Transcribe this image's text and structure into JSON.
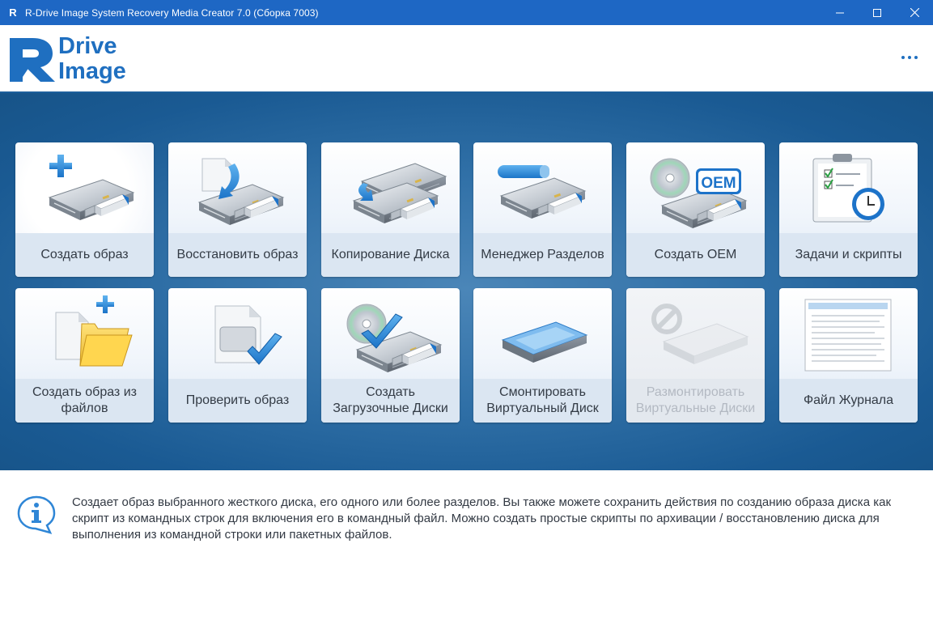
{
  "window": {
    "title": "R-Drive Image System Recovery Media Creator 7.0 (Сборка 7003)",
    "app_icon_letter": "R"
  },
  "header": {
    "logo_line1": "Drive",
    "logo_line2": "Image",
    "brand_color": "#1f6fc0"
  },
  "tiles": [
    {
      "label": "Создать образ",
      "icon": "create-image-icon",
      "state": "selected"
    },
    {
      "label": "Восстановить образ",
      "icon": "restore-image-icon",
      "state": "normal"
    },
    {
      "label": "Копирование Диска",
      "icon": "copy-disk-icon",
      "state": "normal"
    },
    {
      "label": "Менеджер Разделов",
      "icon": "partition-manager-icon",
      "state": "normal"
    },
    {
      "label": "Создать OEM",
      "icon": "create-oem-icon",
      "state": "normal"
    },
    {
      "label": "Задачи и скрипты",
      "icon": "tasks-scripts-icon",
      "state": "normal"
    },
    {
      "label": "Создать образ из файлов",
      "icon": "image-from-files-icon",
      "state": "normal"
    },
    {
      "label": "Проверить образ",
      "icon": "check-image-icon",
      "state": "normal"
    },
    {
      "label": "Создать Загрузочные Диски",
      "icon": "create-boot-disks-icon",
      "state": "normal"
    },
    {
      "label": "Смонтировать Виртуальный Диск",
      "icon": "mount-virtual-disk-icon",
      "state": "normal"
    },
    {
      "label": "Размонтировать Виртуальные Диски",
      "icon": "unmount-virtual-disks-icon",
      "state": "disabled"
    },
    {
      "label": "Файл Журнала",
      "icon": "log-file-icon",
      "state": "normal"
    }
  ],
  "icons_text": {
    "oem_badge": "OEM"
  },
  "info": {
    "text": "Создает образ выбранного жесткого диска, его одного или более разделов. Вы также можете сохранить действия по созданию образа диска как скрипт из командных строк для включения его в командный файл. Можно создать простые скрипты по архивации / восстановлению диска для выполнения из командной строки или пакетных файлов."
  }
}
